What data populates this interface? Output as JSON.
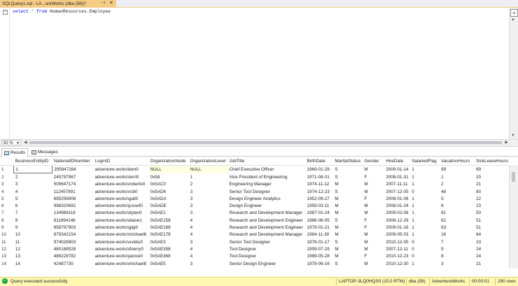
{
  "tab": {
    "title": "SQLQuery1.sql - LA...ureWorks (dba (58))*",
    "pin_icon": "pin-icon",
    "close_icon": "close-icon"
  },
  "editor": {
    "kw_select": "select",
    "op_star": "*",
    "kw_from": "from",
    "table_name": "HumanResources.Employee"
  },
  "zoom": "82 %",
  "result_tabs": [
    "Results",
    "Messages"
  ],
  "grid": {
    "columns": [
      "BusinessEntityID",
      "NationalIDNumber",
      "LoginID",
      "OrganizationNode",
      "OrganizationLevel",
      "JobTitle",
      "BirthDate",
      "MaritalStatus",
      "Gender",
      "HireDate",
      "SalariedFlag",
      "VacationHours",
      "SickLeaveHours"
    ],
    "rows": [
      [
        "1",
        "1",
        "295847284",
        "adventure-works\\ken0",
        "NULL",
        "NULL",
        "Chief Executive Officer",
        "1969-01-29",
        "S",
        "M",
        "2009-01-14",
        "1",
        "99",
        "69"
      ],
      [
        "2",
        "2",
        "245797967",
        "adventure-works\\terri0",
        "0x58",
        "1",
        "Vice President of Engineering",
        "1971-08-01",
        "S",
        "F",
        "2008-01-31",
        "1",
        "1",
        "20"
      ],
      [
        "3",
        "3",
        "509647174",
        "adventure-works\\roberto0",
        "0x5AC0",
        "2",
        "Engineering Manager",
        "1974-11-12",
        "M",
        "M",
        "2007-11-11",
        "1",
        "2",
        "21"
      ],
      [
        "4",
        "4",
        "112457891",
        "adventure-works\\rob0",
        "0x5AD6",
        "3",
        "Senior Tool Designer",
        "1974-12-23",
        "S",
        "M",
        "2007-12-05",
        "0",
        "48",
        "80"
      ],
      [
        "5",
        "5",
        "695256908",
        "adventure-works\\gail0",
        "0x5ADA",
        "3",
        "Design Engineer Analytics",
        "1952-09-27",
        "M",
        "F",
        "2008-01-06",
        "1",
        "5",
        "22"
      ],
      [
        "6",
        "6",
        "998320692",
        "adventure-works\\jossef0",
        "0x5ADE",
        "3",
        "Design Engineer",
        "1959-03-11",
        "M",
        "M",
        "2008-01-24",
        "1",
        "6",
        "23"
      ],
      [
        "7",
        "7",
        "134969118",
        "adventure-works\\dylan0",
        "0x5AE1",
        "3",
        "Research and Development Manager",
        "1987-02-24",
        "M",
        "M",
        "2009-02-08",
        "1",
        "61",
        "50"
      ],
      [
        "8",
        "8",
        "811994146",
        "adventure-works\\diane1",
        "0x5AE158",
        "4",
        "Research and Development Engineer",
        "1986-06-05",
        "S",
        "F",
        "2008-12-29",
        "1",
        "62",
        "51"
      ],
      [
        "9",
        "9",
        "658797903",
        "adventure-works\\gigi0",
        "0x5AE168",
        "4",
        "Research and Development Engineer",
        "1979-01-21",
        "M",
        "F",
        "2009-01-16",
        "1",
        "63",
        "51"
      ],
      [
        "10",
        "10",
        "879342154",
        "adventure-works\\michael6",
        "0x5AE178",
        "4",
        "Research and Development Manager",
        "1984-11-30",
        "M",
        "M",
        "2009-05-03",
        "1",
        "16",
        "64"
      ],
      [
        "11",
        "11",
        "974026903",
        "adventure-works\\ovidiu0",
        "0x5AE3",
        "3",
        "Senior Tool Designer",
        "1978-01-17",
        "S",
        "M",
        "2010-12-05",
        "0",
        "7",
        "23"
      ],
      [
        "12",
        "12",
        "480168528",
        "adventure-works\\thierry0",
        "0x5AE358",
        "4",
        "Tool Designer",
        "1959-07-29",
        "M",
        "M",
        "2007-12-11",
        "0",
        "9",
        "24"
      ],
      [
        "13",
        "13",
        "486228782",
        "adventure-works\\janice0",
        "0x5AE368",
        "4",
        "Tool Designer",
        "1989-05-28",
        "M",
        "F",
        "2010-12-23",
        "0",
        "8",
        "24"
      ],
      [
        "14",
        "14",
        "42487730",
        "adventure-works\\michael8",
        "0x5AE5",
        "3",
        "Senior Design Engineer",
        "1979-06-16",
        "S",
        "M",
        "2010-12-30",
        "1",
        "3",
        "21"
      ]
    ]
  },
  "status": {
    "message": "Query executed successfully.",
    "server": "LAPTOP-3LQ0HQS0 (15.0 RTM)",
    "user": "dba (58)",
    "database": "AdventureWorks",
    "elapsed": "00:00:01",
    "rows": "290 rows"
  }
}
